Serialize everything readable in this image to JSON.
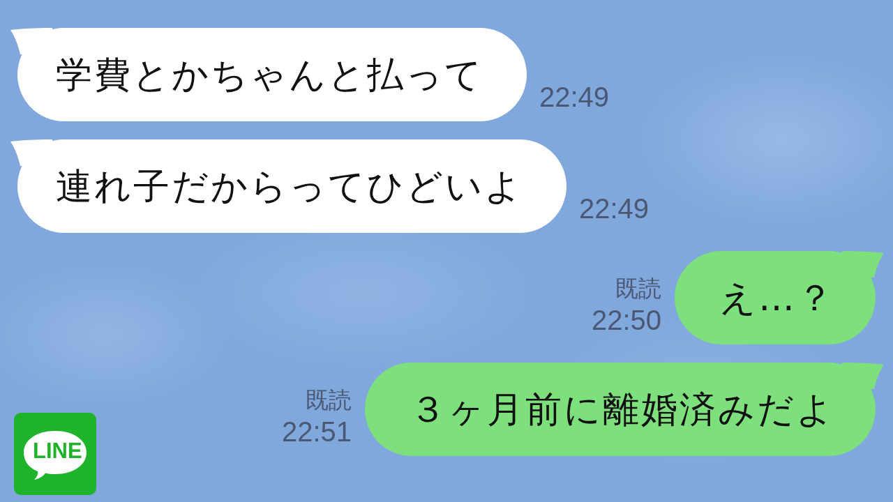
{
  "messages": [
    {
      "kind": "incoming",
      "text": "学費とかちゃんと払って",
      "time": "22:49"
    },
    {
      "kind": "incoming",
      "text": "連れ子だからってひどいよ",
      "time": "22:49"
    },
    {
      "kind": "outgoing",
      "text": "え…？",
      "read_label": "既読",
      "time": "22:50"
    },
    {
      "kind": "outgoing",
      "text": "３ヶ月前に離婚済みだよ",
      "read_label": "既読",
      "time": "22:51"
    }
  ],
  "logo": {
    "text": "LINE"
  }
}
